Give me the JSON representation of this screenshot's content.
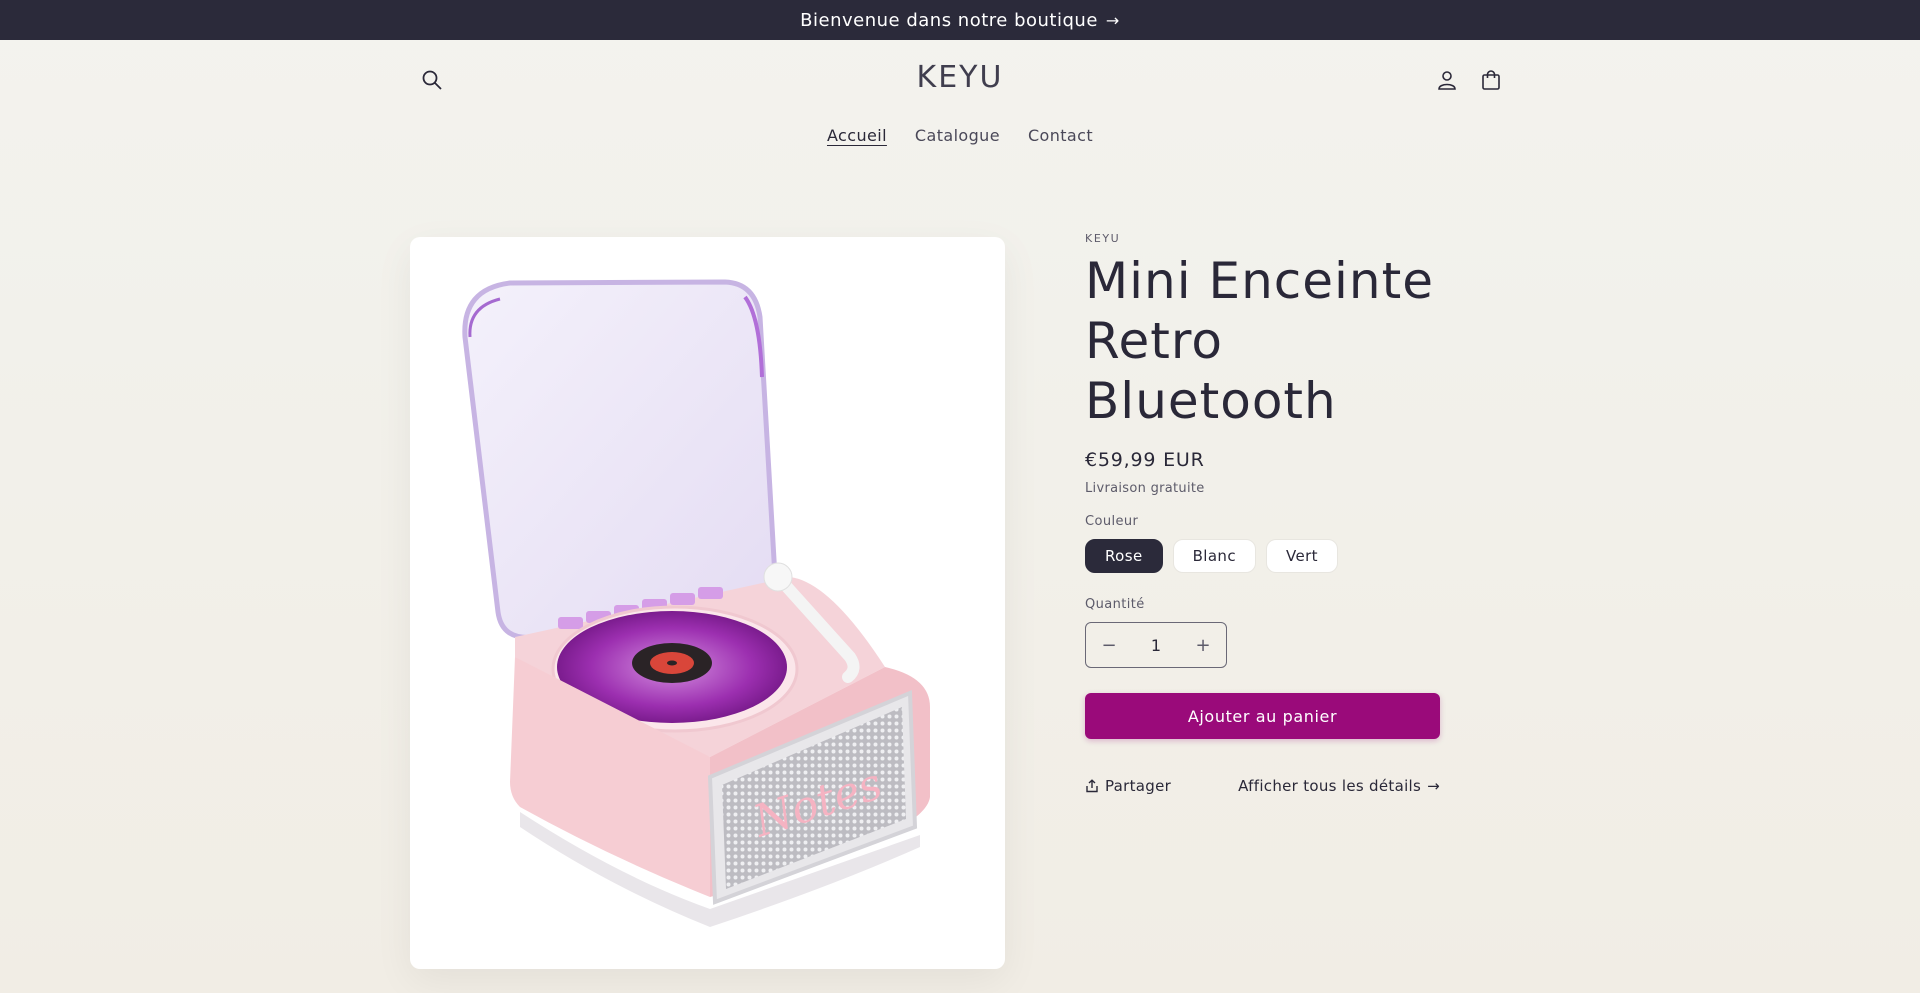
{
  "announcement": {
    "text": "Bienvenue dans notre boutique",
    "arrow": "→"
  },
  "header": {
    "logo": "KEYU",
    "icons": {
      "search": "search-icon",
      "account": "account-icon",
      "cart": "cart-icon"
    }
  },
  "nav": {
    "items": [
      "Accueil",
      "Catalogue",
      "Contact"
    ],
    "active": "Accueil"
  },
  "product": {
    "vendor": "KEYU",
    "title": "Mini Enceinte Retro Bluetooth",
    "price": "€59,99 EUR",
    "shipping": "Livraison gratuite",
    "color_label": "Couleur",
    "colors": [
      "Rose",
      "Blanc",
      "Vert"
    ],
    "selected_color": "Rose",
    "quantity_label": "Quantité",
    "quantity": "1",
    "decrease": "−",
    "increase": "+",
    "add_to_cart": "Ajouter au panier",
    "share": "Partager",
    "details": "Afficher tous les détails",
    "details_arrow": "→"
  },
  "colors": {
    "announcement_bg": "#2b2a3a",
    "primary_button": "#9a0a7a",
    "selected_swatch": "#2b2a3a"
  }
}
